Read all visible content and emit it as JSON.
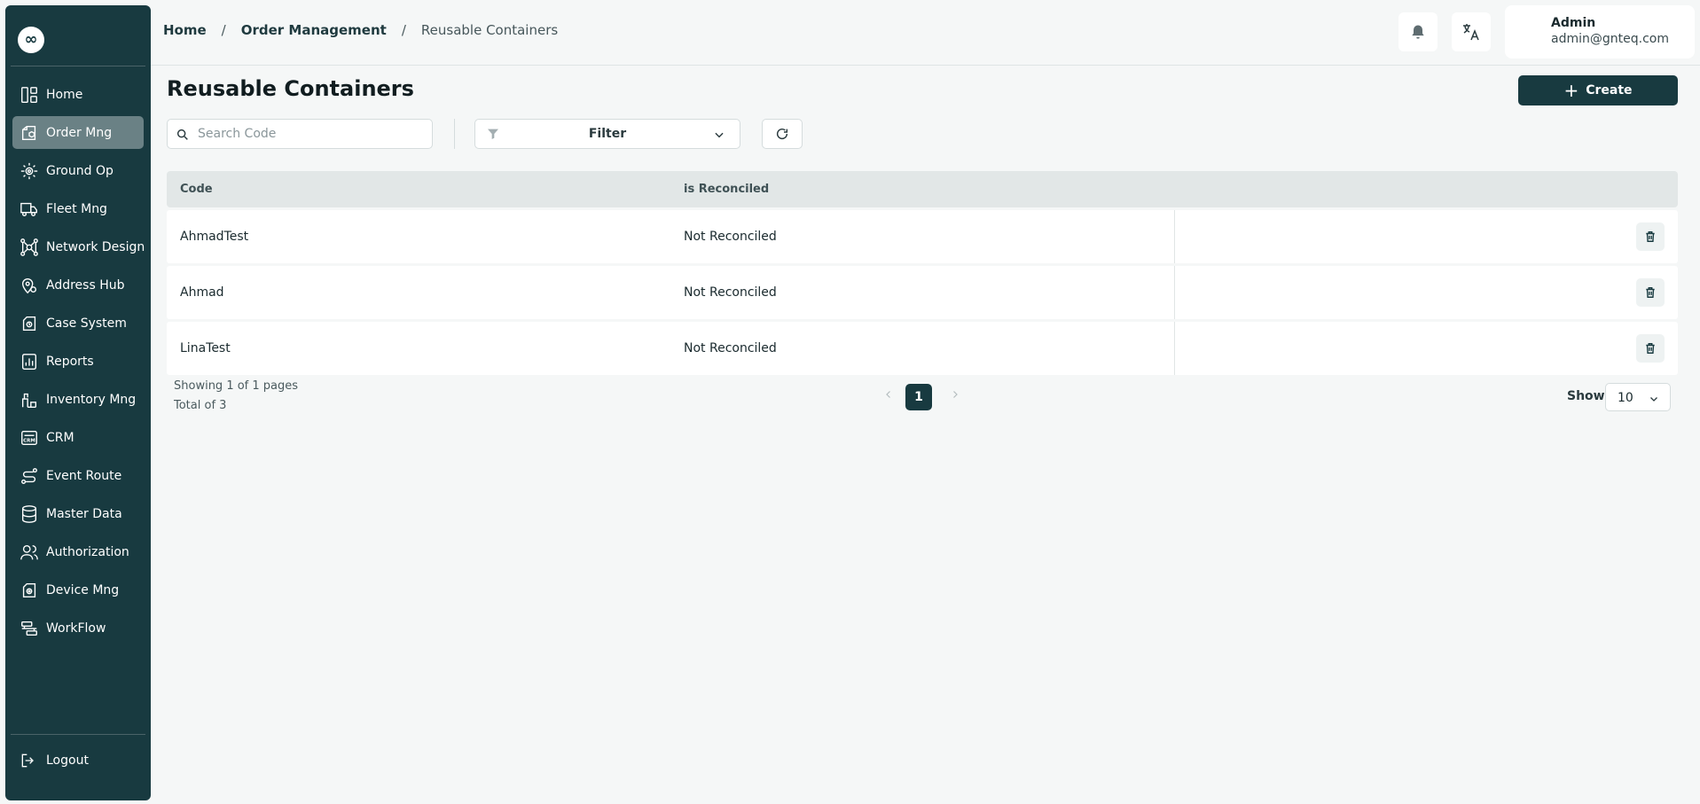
{
  "logo": {
    "glyph": "∞"
  },
  "sidebar": {
    "items": [
      {
        "label": "Home",
        "icon": "dashboard-icon",
        "active": false
      },
      {
        "label": "Order Mng",
        "icon": "order-box-icon",
        "active": true
      },
      {
        "label": "Ground Op",
        "icon": "ground-op-icon",
        "active": false
      },
      {
        "label": "Fleet Mng",
        "icon": "truck-icon",
        "active": false
      },
      {
        "label": "Network Design",
        "icon": "network-icon",
        "active": false
      },
      {
        "label": "Address Hub",
        "icon": "location-pin-icon",
        "active": false
      },
      {
        "label": "Case System",
        "icon": "case-icon",
        "active": false
      },
      {
        "label": "Reports",
        "icon": "report-chart-icon",
        "active": false
      },
      {
        "label": "Inventory Mng",
        "icon": "inventory-icon",
        "active": false
      },
      {
        "label": "CRM",
        "icon": "crm-icon",
        "active": false
      },
      {
        "label": "Event Route",
        "icon": "route-icon",
        "active": false
      },
      {
        "label": "Master Data",
        "icon": "database-icon",
        "active": false
      },
      {
        "label": "Authorization",
        "icon": "users-icon",
        "active": false
      },
      {
        "label": "Device Mng",
        "icon": "device-icon",
        "active": false
      },
      {
        "label": "WorkFlow",
        "icon": "workflow-icon",
        "active": false
      }
    ],
    "logout_label": "Logout"
  },
  "breadcrumb": {
    "items": [
      "Home",
      "Order Management",
      "Reusable Containers"
    ],
    "separator": "/"
  },
  "user": {
    "name": "Admin",
    "email": "admin@gnteq.com"
  },
  "page": {
    "title": "Reusable Containers",
    "create_label": "Create"
  },
  "search": {
    "placeholder": "Search Code",
    "value": ""
  },
  "filter": {
    "label": "Filter"
  },
  "table": {
    "columns": [
      "Code",
      "is Reconciled"
    ],
    "rows": [
      {
        "code": "AhmadTest",
        "status": "Not Reconciled"
      },
      {
        "code": "Ahmad",
        "status": "Not Reconciled"
      },
      {
        "code": "LinaTest",
        "status": "Not Reconciled"
      }
    ]
  },
  "pagination": {
    "showing": "Showing 1 of 1 pages",
    "total": "Total of 3",
    "current_page": "1",
    "show_label": "Show",
    "page_size": "10"
  },
  "colors": {
    "primary": "#183a40",
    "active_nav": "#6a8185",
    "background": "#f5f7f7"
  }
}
